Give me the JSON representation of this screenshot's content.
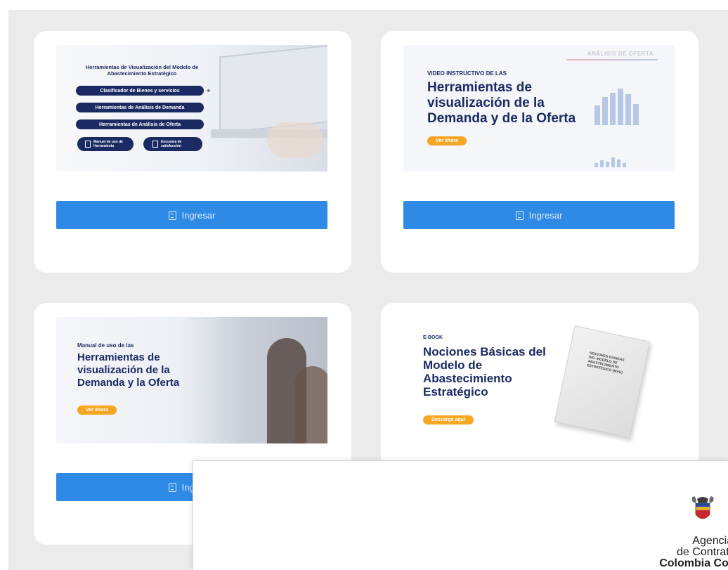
{
  "cards": [
    {
      "title": "Herramientas de Visualización del Modelo de Abastecimiento Estratégico",
      "links": [
        "Clasificador de Bienes y servicios",
        "Herramientas de Análisis de Demanda",
        "Herramientas de Análisis de Oferta"
      ],
      "small_buttons": [
        "Manual de uso de Herramienta",
        "Encuesta de satisfacción"
      ],
      "button_label": "Ingresar"
    },
    {
      "watermark": "ANÁLISIS DE OFERTA",
      "eyebrow": "VIDEO INSTRUCTIVO DE LAS",
      "title": "Herramientas de visualización de la Demanda y de la Oferta",
      "cta": "Ver ahora",
      "button_label": "Ingresar"
    },
    {
      "eyebrow": "Manual de uso de las",
      "title": "Herramientas de visualización de la Demanda y la Oferta",
      "cta": "Ver ahora",
      "button_label": "Ingresar"
    },
    {
      "eyebrow": "E-BOOK",
      "title": "Nociones Básicas del Modelo de Abastecimiento Estratégico",
      "cta": "Descarga aquí",
      "book_cover_text": "NOCIONES BÁSICAS DEL MODELO DE ABASTECIMIENTO ESTRATÉGICO (MAE)"
    }
  ],
  "modal": {
    "agency_line1": "Agencia Nac",
    "agency_line2": "de Contratación",
    "agency_line3": "Colombia Compra"
  },
  "colors": {
    "navy": "#1b2a63",
    "button_blue": "#2f8ae6",
    "orange": "#f6a623",
    "panel_bg": "#ebebeb"
  }
}
